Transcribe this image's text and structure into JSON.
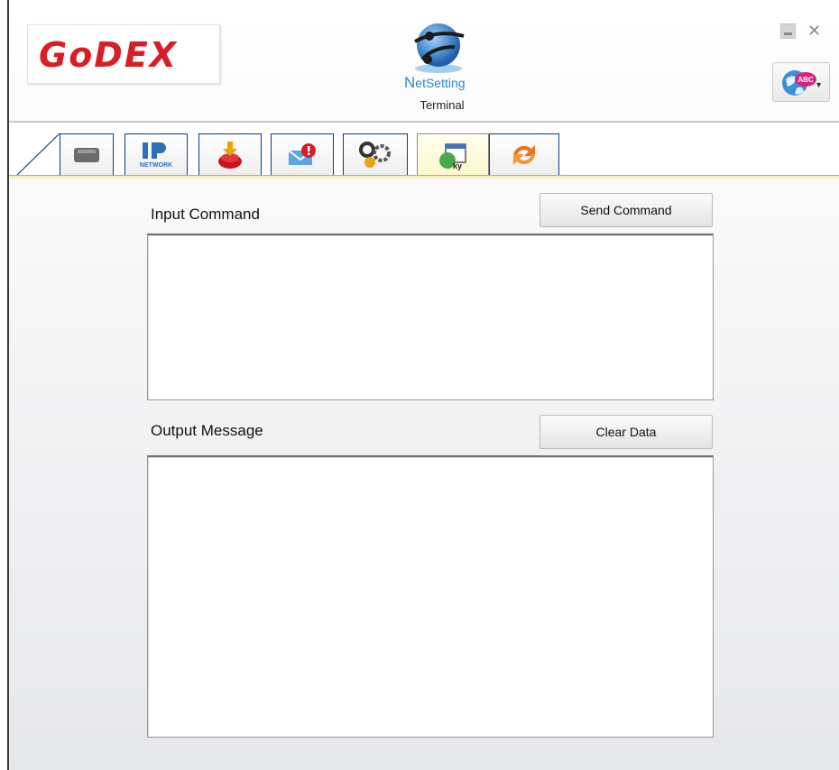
{
  "header": {
    "logo_text": "GoDEX",
    "app_name_prefix": "N",
    "app_name_rest": "etSetting",
    "view_title": "Terminal",
    "language_icon_text": "ABC"
  },
  "tabs": [
    {
      "icon": "printer-icon",
      "active": false
    },
    {
      "icon": "ip-network-icon",
      "label": "NETWORK",
      "active": false
    },
    {
      "icon": "download-icon",
      "active": false
    },
    {
      "icon": "alert-mail-icon",
      "active": false
    },
    {
      "icon": "gear-tools-icon",
      "active": false
    },
    {
      "icon": "terminal-icon",
      "active": true
    },
    {
      "icon": "refresh-icon",
      "active": false
    }
  ],
  "terminal": {
    "input_label": "Input Command",
    "send_button": "Send Command",
    "input_value": "",
    "output_label": "Output Message",
    "clear_button": "Clear Data",
    "output_value": ""
  },
  "colors": {
    "brand_red": "#d81e25",
    "netsetting_blue": "#2f86c8",
    "active_tab": "#fbf6c9",
    "tab_border": "#0b3a8a"
  }
}
